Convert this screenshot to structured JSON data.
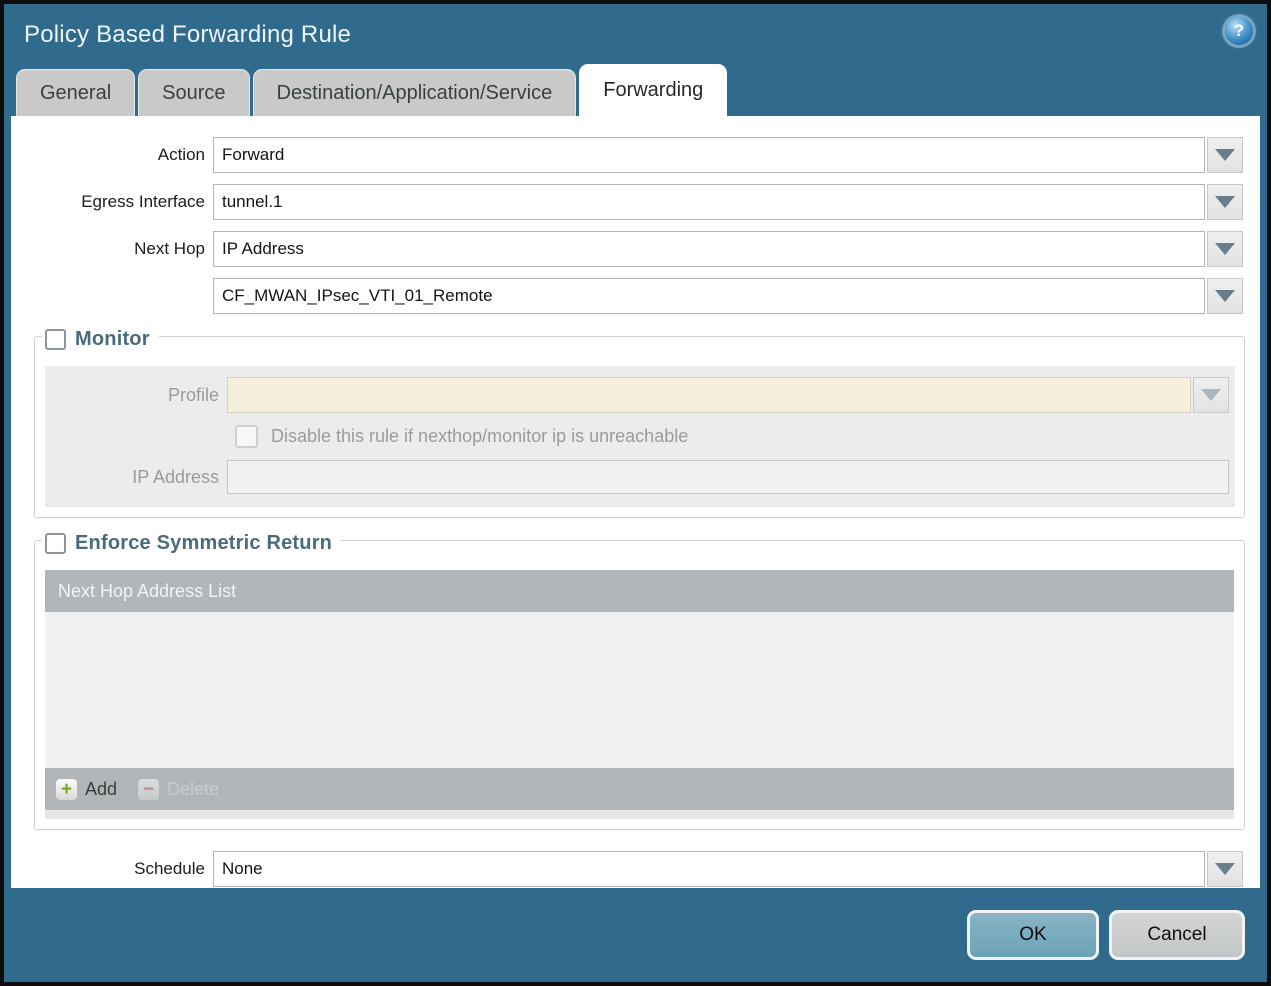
{
  "window": {
    "title": "Policy Based Forwarding Rule",
    "help_glyph": "?"
  },
  "tabs": [
    {
      "label": "General",
      "active": false
    },
    {
      "label": "Source",
      "active": false
    },
    {
      "label": "Destination/Application/Service",
      "active": false
    },
    {
      "label": "Forwarding",
      "active": true
    }
  ],
  "form": {
    "action": {
      "label": "Action",
      "value": "Forward"
    },
    "egress_interface": {
      "label": "Egress Interface",
      "value": "tunnel.1"
    },
    "next_hop": {
      "label": "Next Hop",
      "value": "IP Address"
    },
    "next_hop_address": {
      "value": "CF_MWAN_IPsec_VTI_01_Remote"
    },
    "schedule": {
      "label": "Schedule",
      "value": "None"
    }
  },
  "monitor": {
    "legend": "Monitor",
    "checked": false,
    "profile": {
      "label": "Profile",
      "value": ""
    },
    "disable_rule": {
      "label": "Disable this rule if nexthop/monitor ip is unreachable",
      "checked": false
    },
    "ip_address": {
      "label": "IP Address",
      "value": ""
    }
  },
  "symmetric_return": {
    "legend": "Enforce Symmetric Return",
    "checked": false,
    "table": {
      "header": "Next Hop Address List",
      "rows": []
    },
    "add_label": "Add",
    "delete_label": "Delete"
  },
  "footer": {
    "ok_label": "OK",
    "cancel_label": "Cancel"
  },
  "colors": {
    "chrome_teal": "#306b8e",
    "tab_inactive": "#c9c9c9",
    "legend_text": "#4a6b7d",
    "disabled_panel": "#ececec",
    "profile_field_beige": "#f6efdc",
    "table_chrome_grey": "#b2b6b9",
    "ok_button": "#74a6ba",
    "cancel_button": "#c9cbcc",
    "add_plus_green": "#7ba31e",
    "delete_minus_red": "#c4666e"
  }
}
